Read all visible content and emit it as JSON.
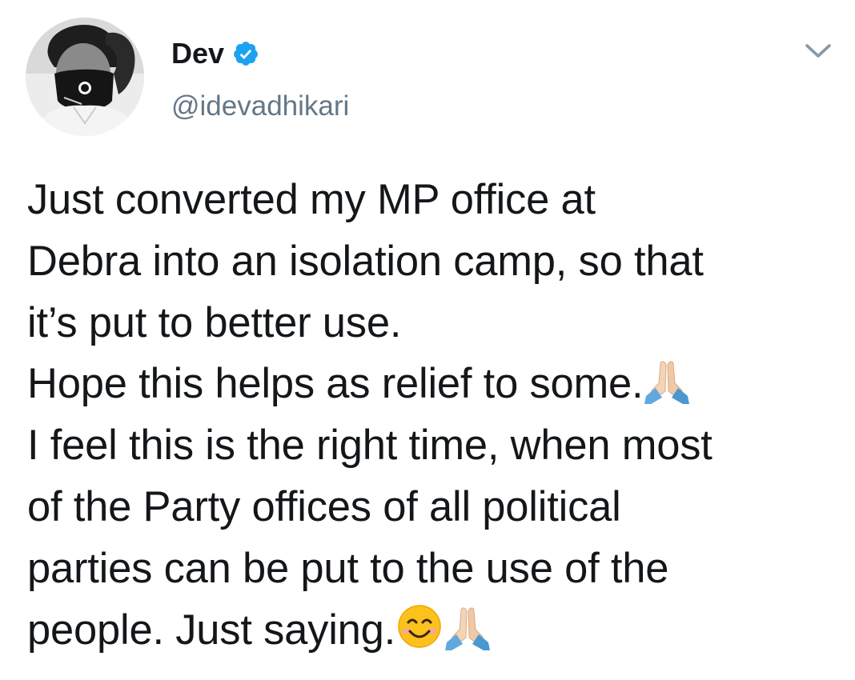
{
  "tweet": {
    "author": {
      "display_name": "Dev",
      "handle": "@idevadhikari",
      "verified": true,
      "avatar_icon": "profile-photo-masked-man"
    },
    "menu_icon": "chevron-down-icon",
    "text_lines": [
      {
        "text": "Just converted my MP office at",
        "emoji": []
      },
      {
        "text": "Debra into an isolation camp, so that",
        "emoji": []
      },
      {
        "text": "it’s put to better use.",
        "emoji": []
      },
      {
        "text": "Hope this helps as relief to some.",
        "emoji": [
          "folded-hands"
        ]
      },
      {
        "text": "I feel this is the right time, when most",
        "emoji": []
      },
      {
        "text": "of the Party offices of all political",
        "emoji": []
      },
      {
        "text": "parties can be put to the use of the",
        "emoji": []
      },
      {
        "text": "people. Just saying.",
        "emoji": [
          "smiling-face-with-smiling-eyes",
          "folded-hands"
        ]
      }
    ]
  },
  "colors": {
    "text": "#14171a",
    "secondary_text": "#657786",
    "verified_blue": "#1da1f2",
    "background": "#ffffff"
  }
}
